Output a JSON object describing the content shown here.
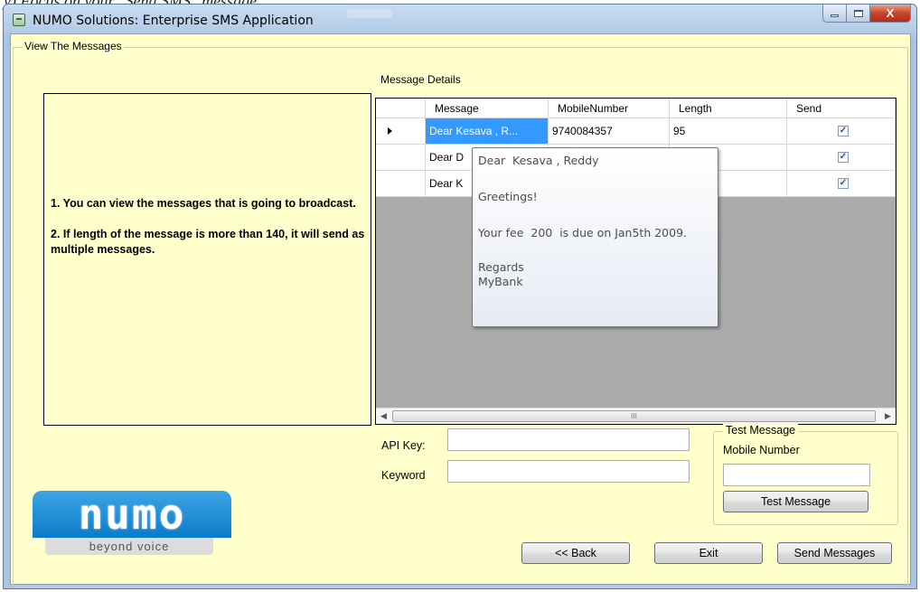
{
  "window": {
    "title": "NUMO Solutions: Enterprise SMS Application",
    "close_glyph": "X"
  },
  "group": {
    "legend": "View The Messages"
  },
  "info": {
    "line1": "1. You can view the messages that is going to broadcast.",
    "line2": "2. If length of the message is more than 140, it will send as multiple messages."
  },
  "details": {
    "label": "Message Details",
    "columns": [
      "Message",
      "MobileNumber",
      "Length",
      "Send"
    ],
    "rows": [
      {
        "message": "Dear  Kesava , R...",
        "mobile": "9740084357",
        "length": "95",
        "send": true
      },
      {
        "message": "Dear  D",
        "mobile": "",
        "length": "",
        "send": true
      },
      {
        "message": "Dear  K",
        "mobile": "",
        "length": "",
        "send": true
      }
    ],
    "scroll_glyph": "III"
  },
  "tooltip": {
    "lines": [
      "Dear  Kesava , Reddy",
      "",
      "Greetings!",
      "",
      "Your fee  200  is due on Jan5th 2009.",
      "",
      "Regards",
      "MyBank"
    ]
  },
  "form": {
    "api_key_label": "API Key:",
    "api_key_value": "",
    "keyword_label": "Keyword",
    "keyword_value": ""
  },
  "test": {
    "legend": "Test Message",
    "mobile_label": "Mobile Number",
    "mobile_value": "",
    "button_label": "Test Message"
  },
  "buttons": {
    "back": "<< Back",
    "exit": "Exit",
    "send": "Send Messages"
  },
  "logo": {
    "text": "numo",
    "tagline": "beyond voice"
  },
  "colors": {
    "client_bg": "#ffffcc",
    "selected_cell": "#3399ff",
    "logo_blue": "#0b7bc7"
  }
}
